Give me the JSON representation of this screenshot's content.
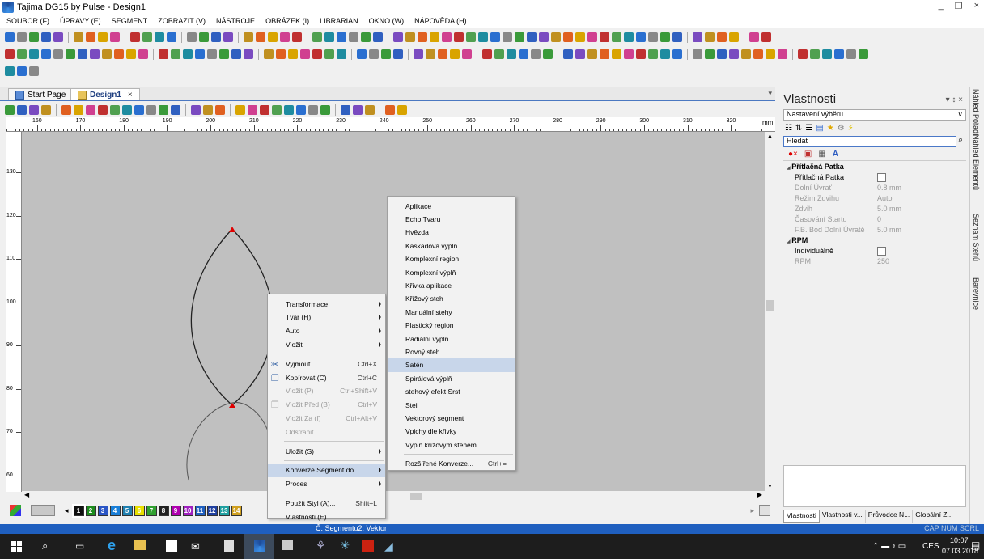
{
  "window": {
    "title": "Tajima DG15 by Pulse - Design1",
    "controls": [
      "_",
      "Ɛ",
      "×"
    ]
  },
  "menu": [
    "SOUBOR (F)",
    "ÚPRAVY (E)",
    "SEGMENT",
    "ZOBRAZIT (V)",
    "NÁSTROJE",
    "OBRÁZEK (I)",
    "LIBRARIAN",
    "OKNO (W)",
    "NÁPOVĚDA (H)"
  ],
  "tabs": {
    "start": "Start Page",
    "design": "Design1",
    "close": "×"
  },
  "ruler": {
    "unit": "mm",
    "top_ticks": [
      "160",
      "170",
      "180",
      "190",
      "200",
      "210",
      "220",
      "230",
      "240",
      "250",
      "260",
      "270",
      "280",
      "290",
      "300",
      "310",
      "320"
    ],
    "left_ticks": [
      "130",
      "120",
      "110",
      "100",
      "90",
      "80",
      "70",
      "60"
    ]
  },
  "context_menu": [
    {
      "label": "Transformace",
      "submenu": true
    },
    {
      "label": "Tvar (H)",
      "submenu": true
    },
    {
      "label": "Auto",
      "submenu": true
    },
    {
      "label": "Vložit",
      "submenu": true
    },
    {
      "sep": true
    },
    {
      "label": "Vyjmout",
      "shortcut": "Ctrl+X",
      "icon": "cut-icon"
    },
    {
      "label": "Kopírovat (C)",
      "shortcut": "Ctrl+C",
      "icon": "copy-icon"
    },
    {
      "label": "Vložit (P)",
      "shortcut": "Ctrl+Shift+V",
      "disabled": true
    },
    {
      "label": "Vložit Před (B)",
      "shortcut": "Ctrl+V",
      "disabled": true,
      "icon": "paste-icon"
    },
    {
      "label": "Vložit Za (f)",
      "shortcut": "Ctrl+Alt+V",
      "disabled": true
    },
    {
      "label": "Odstranit",
      "disabled": true
    },
    {
      "sep": true
    },
    {
      "label": "Uložit (S)",
      "submenu": true
    },
    {
      "sep": true
    },
    {
      "label": "Konverze Segment do",
      "submenu": true,
      "highlight": true
    },
    {
      "label": "Proces",
      "submenu": true
    },
    {
      "sep": true
    },
    {
      "label": "Použít Styl (A)...",
      "shortcut": "Shift+L"
    },
    {
      "label": "Vlastnosti (E)..."
    }
  ],
  "submenu": [
    {
      "label": "Aplikace"
    },
    {
      "label": "Echo Tvaru"
    },
    {
      "label": "Hvězda"
    },
    {
      "label": "Kaskádová výplň"
    },
    {
      "label": "Komplexní region"
    },
    {
      "label": "Komplexní výplň"
    },
    {
      "label": "Křivka aplikace"
    },
    {
      "label": "Křížový steh"
    },
    {
      "label": "Manuální stehy"
    },
    {
      "label": "Plastický region"
    },
    {
      "label": "Radiální výplň"
    },
    {
      "label": "Rovný steh"
    },
    {
      "label": "Satén",
      "highlight": true
    },
    {
      "label": "Spirálová výplň"
    },
    {
      "label": "stehový efekt Srst"
    },
    {
      "label": "Steil"
    },
    {
      "label": "Vektorový segment"
    },
    {
      "label": "Vpichy dle křivky"
    },
    {
      "label": "Výplň křížovým stehem"
    },
    {
      "sep": true
    },
    {
      "label": "Rozšířené Konverze...",
      "shortcut": "Ctrl+="
    }
  ],
  "properties": {
    "title": "Vlastnosti",
    "controls": "▾ ↕ ×",
    "dropdown": "Nastavení výběru",
    "search_placeholder": "Hledat",
    "sections": [
      {
        "name": "Přítlačná Patka",
        "rows": [
          {
            "label": "Přítlačná Patka",
            "value": "",
            "checkbox": true,
            "enabled": true
          },
          {
            "label": "Dolní Úvrať",
            "value": "0.8 mm",
            "enabled": false
          },
          {
            "label": "Režim Zdvihu",
            "value": "Auto",
            "enabled": false
          },
          {
            "label": "Zdvih",
            "value": "5.0 mm",
            "enabled": false
          },
          {
            "label": "Časování Startu",
            "value": "0",
            "enabled": false
          },
          {
            "label": "F.B. Bod Dolní Úvratě",
            "value": "5.0 mm",
            "enabled": false
          }
        ]
      },
      {
        "name": "RPM",
        "rows": [
          {
            "label": "Individuálně",
            "value": "",
            "checkbox": true,
            "enabled": true
          },
          {
            "label": "RPM",
            "value": "250",
            "enabled": false
          }
        ]
      }
    ],
    "bottom_tabs": [
      "Vlastnosti",
      "Vlastnosti v...",
      "Průvodce N...",
      "Globální Z..."
    ]
  },
  "side_tabs": [
    "Náhled Pořadí",
    "Náhled Elementů",
    "Seznam Stehů",
    "Barevnice"
  ],
  "color_chips": [
    {
      "n": "1",
      "c": "#101010"
    },
    {
      "n": "2",
      "c": "#1e8c1e"
    },
    {
      "n": "3",
      "c": "#2a56c6"
    },
    {
      "n": "4",
      "c": "#1a7fd8"
    },
    {
      "n": "5",
      "c": "#2080b0"
    },
    {
      "n": "6",
      "c": "#e8e000"
    },
    {
      "n": "7",
      "c": "#30a030"
    },
    {
      "n": "8",
      "c": "#202020"
    },
    {
      "n": "9",
      "c": "#b000b0"
    },
    {
      "n": "10",
      "c": "#a020c0"
    },
    {
      "n": "11",
      "c": "#2060c0"
    },
    {
      "n": "12",
      "c": "#2040a0"
    },
    {
      "n": "13",
      "c": "#20a0a0"
    },
    {
      "n": "14",
      "c": "#d0a020"
    }
  ],
  "status": {
    "center": "Č. Segmentu2, Vektor",
    "right": "CAP NUM SCRL"
  },
  "taskbar": {
    "lang": "CES",
    "time": "10:07",
    "date": "07.03.2018"
  }
}
